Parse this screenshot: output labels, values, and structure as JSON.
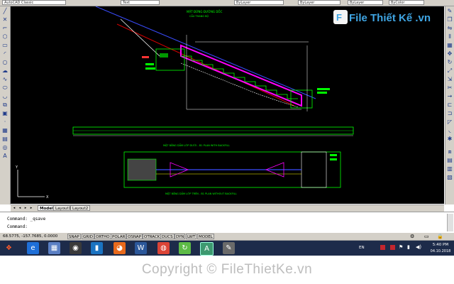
{
  "toolbar": {
    "workspace": "AutoCAD Classic",
    "textstyle": "Text",
    "layer": "ByLayer",
    "linetype": "ByLayer",
    "lineweight": "ByLayer",
    "color": "ByColor"
  },
  "watermark_logo": {
    "text": "File Thiết Kế .vn"
  },
  "drawing": {
    "title_top_1": "MẶT ĐỨNG ĐƯỜNG DỐC",
    "title_top_2": "CẦU THANG BỘ",
    "caption_1": "MẶT BẰNG DẦM LỚP DƯỚI - B1 PLAN WITH BACKFILL",
    "caption_2": "MẶT BẰNG DẦM LỚP TRÊN - B1 PLAN WITHOUT BACKFILL"
  },
  "tabs": {
    "model": "Model",
    "layout1": "Layout1",
    "layout2": "Layout2"
  },
  "command": {
    "line1": "Command: _qsave",
    "line2": "Command:"
  },
  "status": {
    "coords": "68.5775, -157.7685, 0.0000",
    "buttons": [
      "SNAP",
      "GRID",
      "ORTHO",
      "POLAR",
      "OSNAP",
      "OTRACK",
      "DUCS",
      "DYN",
      "LWT",
      "MODEL"
    ]
  },
  "tray": {
    "lang": "EN",
    "time": "5:40 PM",
    "date": "04.10.2018"
  },
  "footer": {
    "copyright": "Copyright © FileThietKe.vn"
  }
}
